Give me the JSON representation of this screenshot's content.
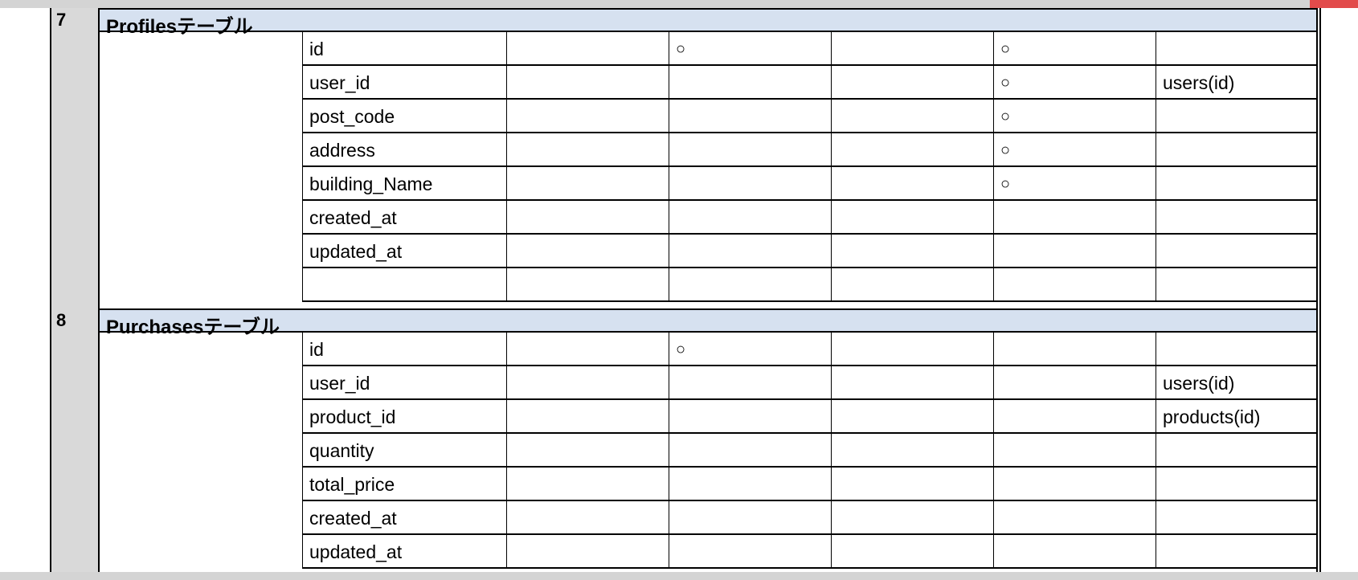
{
  "sections": [
    {
      "number": "7",
      "title": "Profilesテーブル",
      "rows": [
        {
          "name": "id",
          "c1": "",
          "c2": "○",
          "c3": "",
          "c4": "○",
          "c5": ""
        },
        {
          "name": "user_id",
          "c1": "",
          "c2": "",
          "c3": "",
          "c4": "○",
          "c5": "users(id)"
        },
        {
          "name": "post_code",
          "c1": "",
          "c2": "",
          "c3": "",
          "c4": "○",
          "c5": ""
        },
        {
          "name": "address",
          "c1": "",
          "c2": "",
          "c3": "",
          "c4": "○",
          "c5": ""
        },
        {
          "name": "building_Name",
          "c1": "",
          "c2": "",
          "c3": "",
          "c4": "○",
          "c5": ""
        },
        {
          "name": "created_at",
          "c1": "",
          "c2": "",
          "c3": "",
          "c4": "",
          "c5": ""
        },
        {
          "name": "updated_at",
          "c1": "",
          "c2": "",
          "c3": "",
          "c4": "",
          "c5": ""
        },
        {
          "name": "",
          "c1": "",
          "c2": "",
          "c3": "",
          "c4": "",
          "c5": ""
        }
      ]
    },
    {
      "number": "8",
      "title": "Purchasesテーブル",
      "rows": [
        {
          "name": "id",
          "c1": "",
          "c2": "○",
          "c3": "",
          "c4": "",
          "c5": ""
        },
        {
          "name": "user_id",
          "c1": "",
          "c2": "",
          "c3": "",
          "c4": "",
          "c5": "users(id)"
        },
        {
          "name": "product_id",
          "c1": "",
          "c2": "",
          "c3": "",
          "c4": "",
          "c5": "products(id)"
        },
        {
          "name": "quantity",
          "c1": "",
          "c2": "",
          "c3": "",
          "c4": "",
          "c5": ""
        },
        {
          "name": "total_price",
          "c1": "",
          "c2": "",
          "c3": "",
          "c4": "",
          "c5": ""
        },
        {
          "name": "created_at",
          "c1": "",
          "c2": "",
          "c3": "",
          "c4": "",
          "c5": ""
        },
        {
          "name": "updated_at",
          "c1": "",
          "c2": "",
          "c3": "",
          "c4": "",
          "c5": ""
        }
      ]
    }
  ],
  "colors": {
    "header_fill": "#d6e1f0",
    "rownum_fill": "#d9d9d9",
    "grid_line": "#000000"
  }
}
